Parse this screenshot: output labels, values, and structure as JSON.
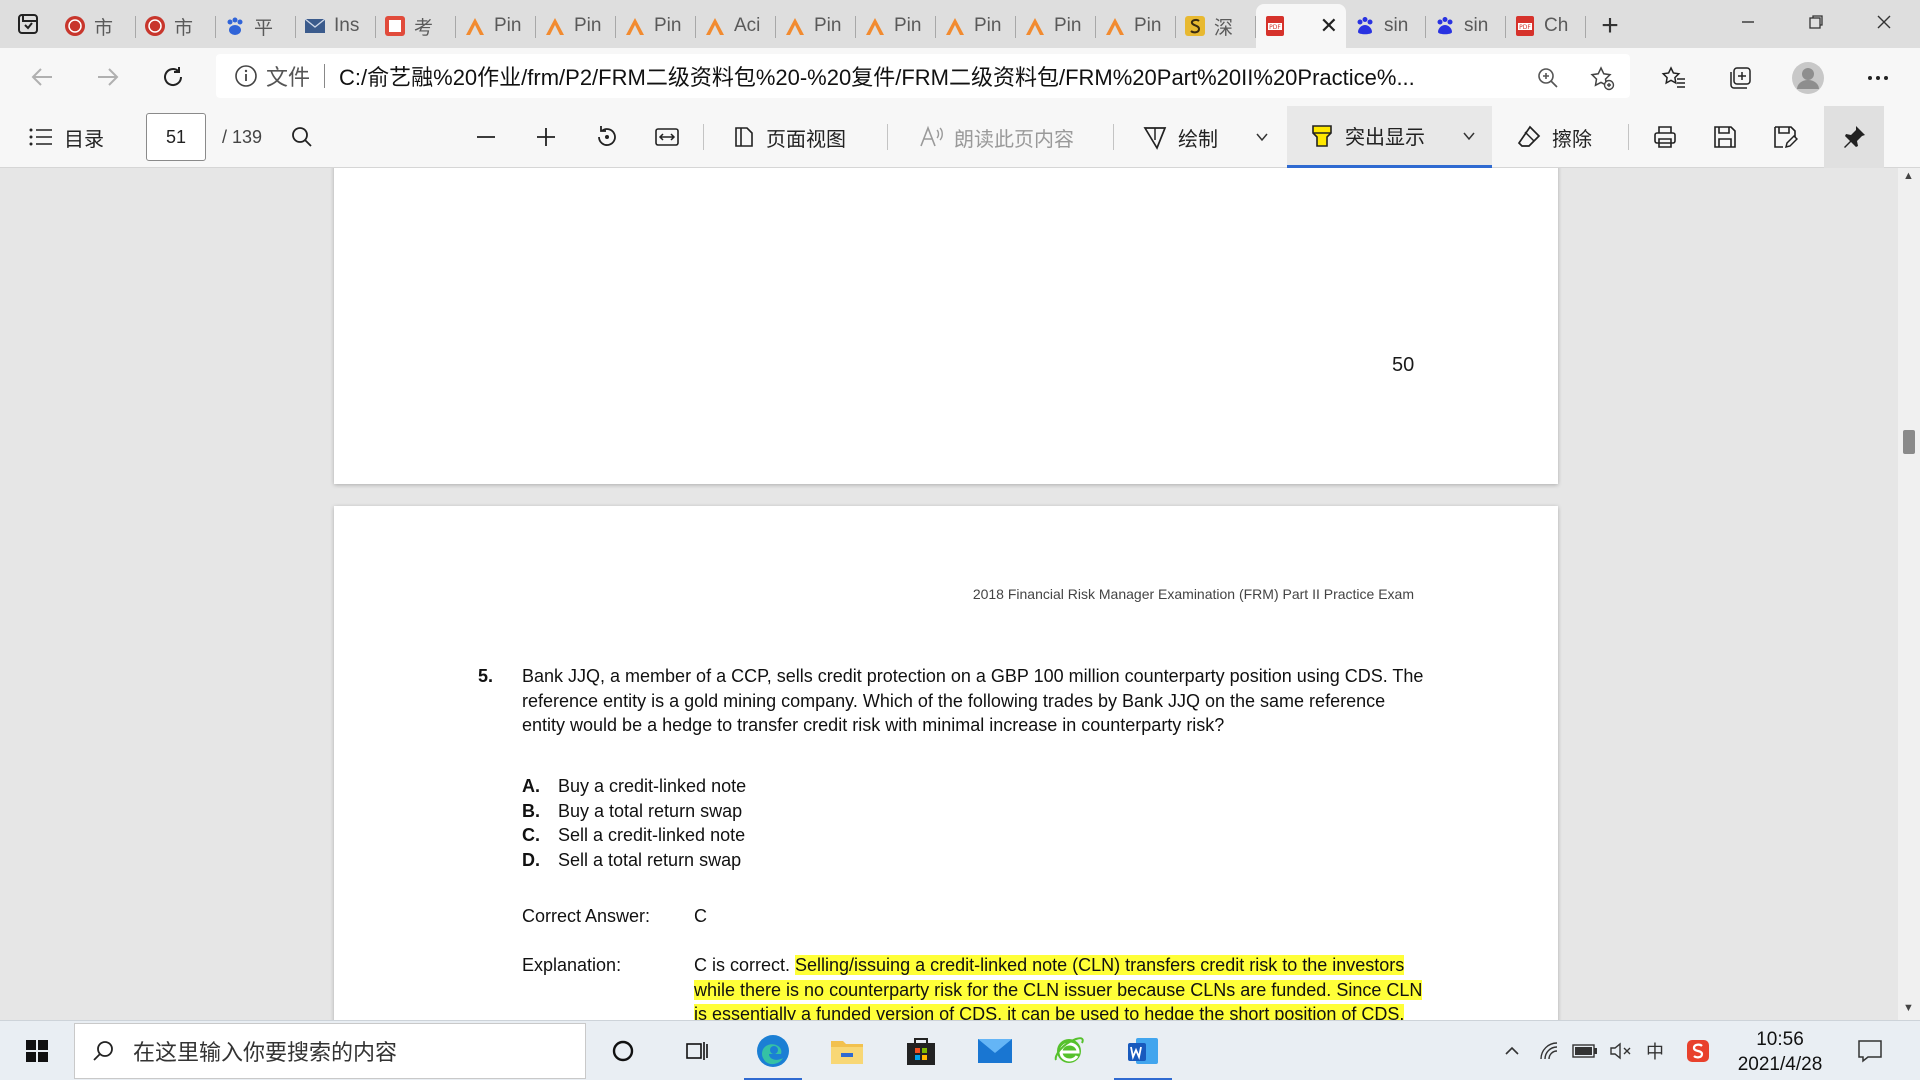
{
  "tabs": [
    {
      "title": "市",
      "icon": "red-seal-icon"
    },
    {
      "title": "市",
      "icon": "red-seal-icon"
    },
    {
      "title": "平",
      "icon": "paw-icon"
    },
    {
      "title": "Ins",
      "icon": "mail-icon"
    },
    {
      "title": "考",
      "icon": "red-square-icon"
    },
    {
      "title": "Pin",
      "icon": "orange-a-icon"
    },
    {
      "title": "Pin",
      "icon": "orange-a-icon"
    },
    {
      "title": "Pin",
      "icon": "orange-a-icon"
    },
    {
      "title": "Aci",
      "icon": "orange-a-icon"
    },
    {
      "title": "Pin",
      "icon": "orange-a-icon"
    },
    {
      "title": "Pin",
      "icon": "orange-a-icon"
    },
    {
      "title": "Pin",
      "icon": "orange-a-icon"
    },
    {
      "title": "Pin",
      "icon": "orange-a-icon"
    },
    {
      "title": "Pin",
      "icon": "orange-a-icon"
    },
    {
      "title": "深",
      "icon": "yellow-s-icon"
    },
    {
      "title": "",
      "icon": "pdf-icon",
      "active": true
    },
    {
      "title": "sin",
      "icon": "baidu-icon"
    },
    {
      "title": "sin",
      "icon": "baidu-icon"
    },
    {
      "title": "Ch",
      "icon": "pdf-icon"
    }
  ],
  "address": {
    "file_label": "文件",
    "url": "C:/俞艺融%20作业/frm/P2/FRM二级资料包%20-%20复件/FRM二级资料包/FRM%20Part%20II%20Practice%..."
  },
  "pdf_toolbar": {
    "toc_label": "目录",
    "page_current": "51",
    "page_total": "/ 139",
    "page_view_label": "页面视图",
    "read_aloud_label": "朗读此页内容",
    "draw_label": "绘制",
    "highlight_label": "突出显示",
    "erase_label": "擦除"
  },
  "page_prev": {
    "page_number": "50"
  },
  "page_current": {
    "running_head": "2018 Financial Risk Manager Examination (FRM) Part II Practice Exam",
    "question_number": "5.",
    "question_lines": [
      "Bank JJQ, a member of a CCP, sells credit protection on a GBP 100 million counterparty position using CDS. The",
      "reference entity is a gold mining company. Which of the following trades by Bank JJQ on the same reference",
      "entity would be a hedge to transfer credit risk with minimal increase in counterparty risk?"
    ],
    "options": [
      {
        "letter": "A.",
        "text": "Buy a credit-linked note"
      },
      {
        "letter": "B.",
        "text": "Buy a total return swap"
      },
      {
        "letter": "C.",
        "text": "Sell a credit-linked note"
      },
      {
        "letter": "D.",
        "text": "Sell a total return swap"
      }
    ],
    "correct_answer_label": "Correct Answer:",
    "correct_answer_value": "C",
    "explanation_label": "Explanation:",
    "explanation_prefix": "C is correct. ",
    "explanation_hl_1": "Selling/issuing a credit-linked note (CLN) transfers credit risk to the investors",
    "explanation_hl_2": "while there is no counterparty risk for the CLN issuer because CLNs are funded. Since CLN",
    "explanation_hl_3": "is essentially a funded version of CDS, it can be used to hedge the short position of CDS."
  },
  "taskbar": {
    "search_placeholder": "在这里输入你要搜索的内容",
    "ime_label": "中",
    "time": "10:56",
    "date": "2021/4/28"
  },
  "colors": {
    "highlight": "#ffff38",
    "accent": "#2f6ad1"
  }
}
